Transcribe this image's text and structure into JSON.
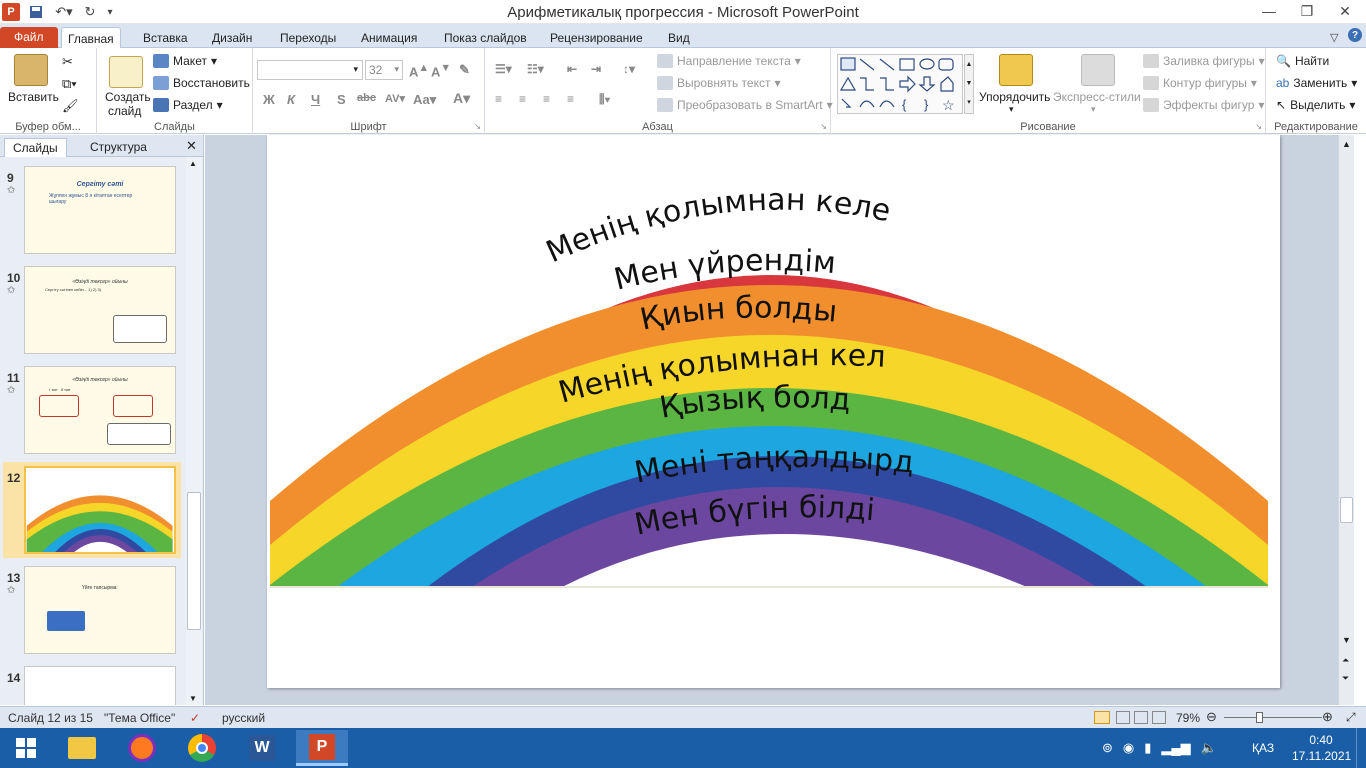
{
  "window": {
    "title": "Арифметикалық прогрессия  -  Microsoft PowerPoint",
    "app_badge": "P"
  },
  "tabs": [
    "Файл",
    "Главная",
    "Вставка",
    "Дизайн",
    "Переходы",
    "Анимация",
    "Показ слайдов",
    "Рецензирование",
    "Вид"
  ],
  "ribbon": {
    "clipboard": {
      "paste": "Вставить",
      "label": "Буфер обм..."
    },
    "slides": {
      "new_slide_1": "Создать",
      "new_slide_2": "слайд",
      "layout": "Макет",
      "reset": "Восстановить",
      "section": "Раздел",
      "label": "Слайды"
    },
    "font": {
      "size": "32",
      "label": "Шрифт",
      "bold": "Ж",
      "italic": "К",
      "underline": "Ч",
      "shadow": "S",
      "strike": "abc",
      "spacing": "AV",
      "case": "Аа",
      "color": "A"
    },
    "paragraph": {
      "text_direction": "Направление текста",
      "align_text": "Выровнять текст",
      "smartart": "Преобразовать в SmartArt",
      "label": "Абзац"
    },
    "drawing": {
      "arrange": "Упорядочить",
      "quick_styles": "Экспресс-стили",
      "fill": "Заливка фигуры",
      "outline": "Контур фигуры",
      "effects": "Эффекты фигур",
      "label": "Рисование"
    },
    "editing": {
      "find": "Найти",
      "replace": "Заменить",
      "select": "Выделить",
      "label": "Редактирование"
    }
  },
  "left_pane": {
    "tab_slides": "Слайды",
    "tab_outline": "Структура"
  },
  "thumbnails": [
    {
      "num": "9",
      "title": "Сергіту сәті",
      "body": "Жұппен жұмыс 8 ә кітаптан есептер шығару"
    },
    {
      "num": "10",
      "title": "«Өзіңді тексер» ойыны",
      "body": "Сергіту сәтінен кейін... 1) 2) 3)"
    },
    {
      "num": "11",
      "title": "«Өзіңді тексер» ойыны",
      "body": "I топ   II топ"
    },
    {
      "num": "12",
      "title": "",
      "body": ""
    },
    {
      "num": "13",
      "title": "Үйге тапсырма:",
      "body": ""
    },
    {
      "num": "14",
      "title": "",
      "body": ""
    }
  ],
  "slide": {
    "arc_texts": [
      "Менің қолымнан келеді",
      "Мен үйрендім",
      "Қиын болды",
      "Менің қолымнан келді",
      "Қызық болды",
      "Мені таңқалдырды",
      "Мен бүгін білдім"
    ],
    "band_colors": [
      "#d7373d",
      "#f18f2e",
      "#f7d62a",
      "#5bb543",
      "#1da6df",
      "#2f4aa0",
      "#6c47a0"
    ]
  },
  "status": {
    "slide_info": "Слайд 12 из 15",
    "theme": "\"Тема Office\"",
    "language": "русский",
    "zoom": "79%"
  },
  "taskbar": {
    "lang": "ҚАЗ",
    "time": "0:40",
    "date": "17.11.2021"
  }
}
